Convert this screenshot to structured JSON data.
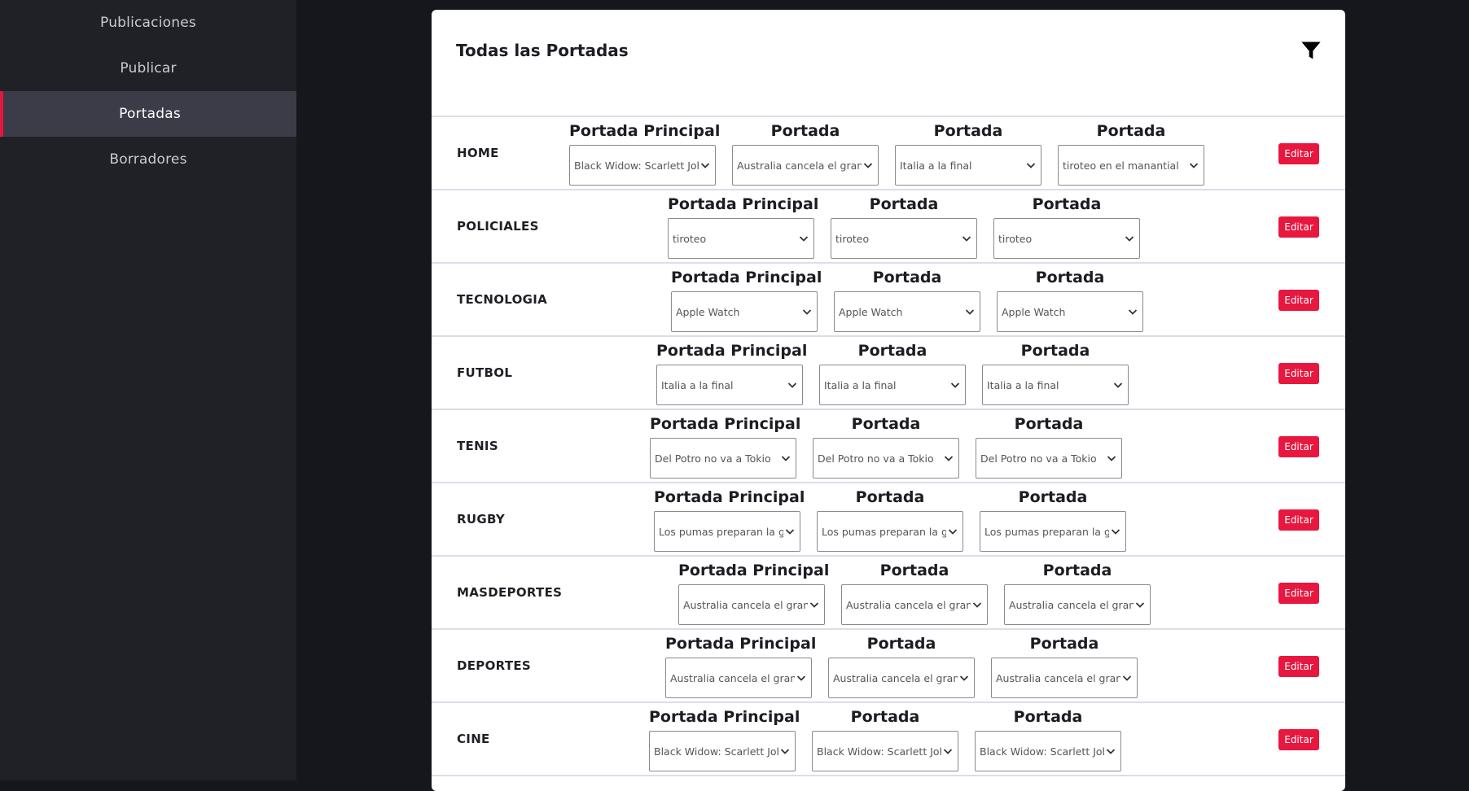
{
  "sidebar": {
    "items": [
      {
        "label": "Publicaciones"
      },
      {
        "label": "Publicar"
      },
      {
        "label": "Portadas"
      },
      {
        "label": "Borradores"
      }
    ],
    "active_index": 2
  },
  "main": {
    "title": "Todas las Portadas",
    "edit_label": "Editar",
    "sections": [
      {
        "name": "HOME",
        "slots": [
          {
            "label": "Portada Principal",
            "value": "Black Widow: Scarlett Johansson"
          },
          {
            "label": "Portada",
            "value": "Australia cancela el gran premio"
          },
          {
            "label": "Portada",
            "value": "Italia a la final"
          },
          {
            "label": "Portada",
            "value": "tiroteo en el manantial"
          }
        ]
      },
      {
        "name": "POLICIALES",
        "slots": [
          {
            "label": "Portada Principal",
            "value": "tiroteo"
          },
          {
            "label": "Portada",
            "value": "tiroteo"
          },
          {
            "label": "Portada",
            "value": "tiroteo"
          }
        ]
      },
      {
        "name": "TECNOLOGIA",
        "slots": [
          {
            "label": "Portada Principal",
            "value": "Apple Watch"
          },
          {
            "label": "Portada",
            "value": "Apple Watch"
          },
          {
            "label": "Portada",
            "value": "Apple Watch"
          }
        ]
      },
      {
        "name": "FUTBOL",
        "slots": [
          {
            "label": "Portada Principal",
            "value": "Italia a la final"
          },
          {
            "label": "Portada",
            "value": "Italia a la final"
          },
          {
            "label": "Portada",
            "value": "Italia a la final"
          }
        ]
      },
      {
        "name": "TENIS",
        "slots": [
          {
            "label": "Portada Principal",
            "value": "Del Potro no va a Tokio"
          },
          {
            "label": "Portada",
            "value": "Del Potro no va a Tokio"
          },
          {
            "label": "Portada",
            "value": "Del Potro no va a Tokio"
          }
        ]
      },
      {
        "name": "RUGBY",
        "slots": [
          {
            "label": "Portada Principal",
            "value": "Los pumas preparan la gira"
          },
          {
            "label": "Portada",
            "value": "Los pumas preparan la gira"
          },
          {
            "label": "Portada",
            "value": "Los pumas preparan la gira"
          }
        ]
      },
      {
        "name": "MASDEPORTES",
        "slots": [
          {
            "label": "Portada Principal",
            "value": "Australia cancela el gran premio"
          },
          {
            "label": "Portada",
            "value": "Australia cancela el gran premio"
          },
          {
            "label": "Portada",
            "value": "Australia cancela el gran premio"
          }
        ]
      },
      {
        "name": "DEPORTES",
        "slots": [
          {
            "label": "Portada Principal",
            "value": "Australia cancela el gran premio"
          },
          {
            "label": "Portada",
            "value": "Australia cancela el gran premio"
          },
          {
            "label": "Portada",
            "value": "Australia cancela el gran premio"
          }
        ]
      },
      {
        "name": "CINE",
        "slots": [
          {
            "label": "Portada Principal",
            "value": "Black Widow: Scarlett Johansson"
          },
          {
            "label": "Portada",
            "value": "Black Widow: Scarlett Johansson"
          },
          {
            "label": "Portada",
            "value": "Black Widow: Scarlett Johansson"
          }
        ]
      }
    ]
  },
  "colors": {
    "accent": "#e8173f",
    "sidebar_bg": "#202127",
    "page_bg": "#16171c"
  }
}
